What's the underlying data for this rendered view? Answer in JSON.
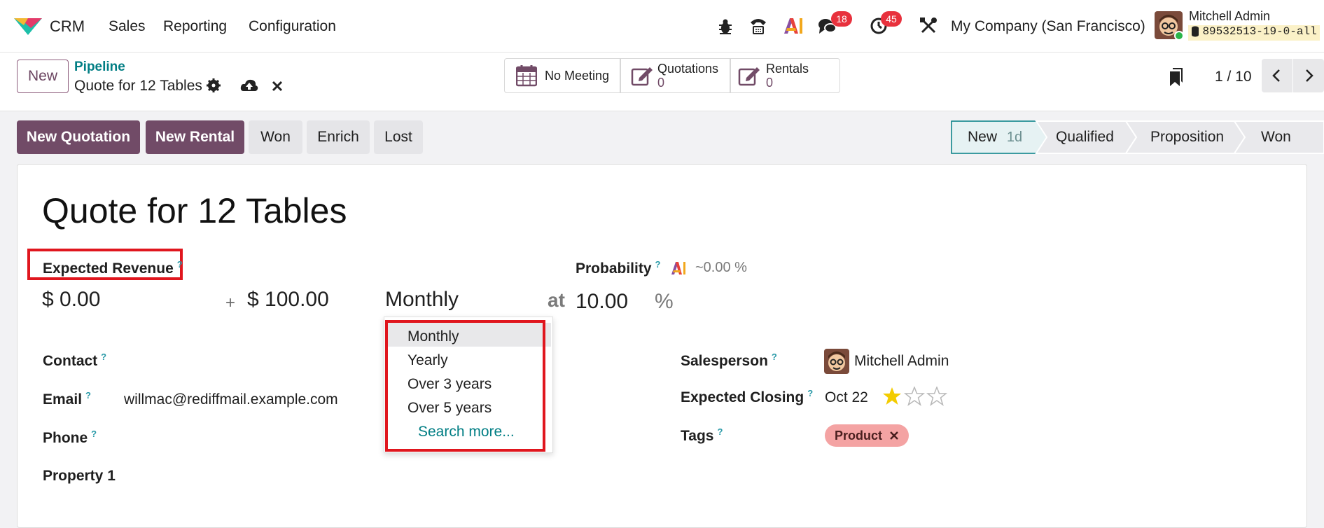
{
  "navbar": {
    "app_name": "CRM",
    "menus": [
      "Sales",
      "Reporting",
      "Configuration"
    ],
    "messages_badge": "18",
    "activities_badge": "45",
    "company": "My Company (San Francisco)",
    "user_name": "Mitchell Admin",
    "database": "89532513-19-0-all"
  },
  "control": {
    "new_label": "New",
    "breadcrumb_parent": "Pipeline",
    "record_title": "Quote for 12 Tables",
    "smart_buttons": [
      {
        "label": "No Meeting",
        "value": ""
      },
      {
        "label": "Quotations",
        "value": "0"
      },
      {
        "label": "Rentals",
        "value": "0"
      }
    ],
    "pager": "1 / 10"
  },
  "statusbar": {
    "buttons": [
      "New Quotation",
      "New Rental",
      "Won",
      "Enrich",
      "Lost"
    ],
    "stages": [
      {
        "label": "New",
        "duration": "1d",
        "active": true
      },
      {
        "label": "Qualified",
        "duration": "",
        "active": false
      },
      {
        "label": "Proposition",
        "duration": "",
        "active": false
      },
      {
        "label": "Won",
        "duration": "",
        "active": false
      }
    ]
  },
  "form": {
    "title": "Quote for 12 Tables",
    "expected_revenue_label": "Expected Revenue",
    "expected_revenue": "$ 0.00",
    "plus": "+",
    "recurring_revenue": "$ 100.00",
    "recurring_plan": "Monthly",
    "at": "at",
    "probability_label": "Probability",
    "ai_probability": "~0.00 %",
    "probability": "10.00",
    "percent": "%",
    "contact_label": "Contact",
    "email_label": "Email",
    "email": "willmac@rediffmail.example.com",
    "phone_label": "Phone",
    "property_label": "Property 1",
    "salesperson_label": "Salesperson",
    "salesperson": "Mitchell Admin",
    "expected_closing_label": "Expected Closing",
    "expected_closing": "Oct 22",
    "priority_stars": 1,
    "tags_label": "Tags",
    "tag": "Product",
    "help_mark": "?"
  },
  "dropdown": {
    "options": [
      "Monthly",
      "Yearly",
      "Over 3 years",
      "Over 5 years"
    ],
    "highlighted": "Monthly",
    "search_more": "Search more..."
  },
  "colors": {
    "primary": "#714b67",
    "link": "#017e84",
    "highlight": "#e0161e",
    "tag_bg": "#f4a3a3",
    "star": "#f3cc00"
  }
}
